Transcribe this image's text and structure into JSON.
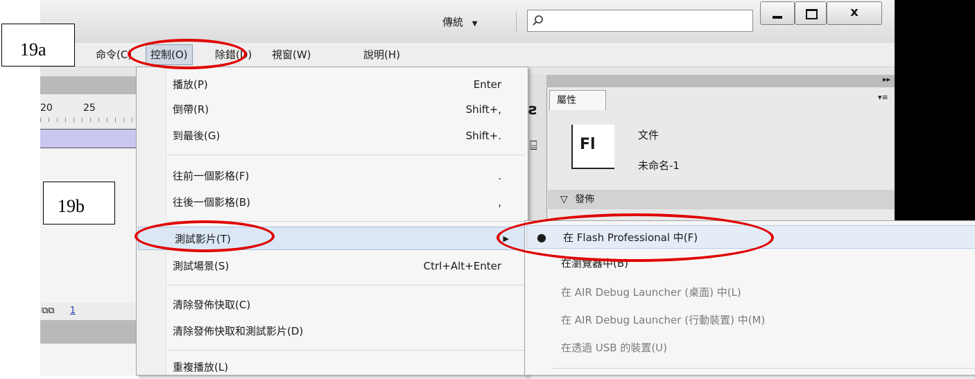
{
  "titlebar": {
    "workspace_label": "傳統",
    "search_placeholder": ""
  },
  "window_controls": {
    "minimize": "_",
    "maximize": "□",
    "close": "x"
  },
  "menubar": {
    "items": [
      "命令(C)",
      "控制(O)",
      "除錯(D)",
      "視窗(W)",
      "說明(H)"
    ]
  },
  "timeline": {
    "ticks": [
      "20",
      "25"
    ],
    "frame_number": "1"
  },
  "control_menu": {
    "items": [
      {
        "label": "播放(P)",
        "shortcut": "Enter"
      },
      {
        "label": "倒帶(R)",
        "shortcut": "Shift+,"
      },
      {
        "label": "到最後(G)",
        "shortcut": "Shift+."
      },
      {
        "label": "往前一個影格(F)",
        "shortcut": "."
      },
      {
        "label": "往後一個影格(B)",
        "shortcut": ","
      },
      {
        "label": "測試影片(T)",
        "shortcut": ""
      },
      {
        "label": "測試場景(S)",
        "shortcut": "Ctrl+Alt+Enter"
      },
      {
        "label": "清除發佈快取(C)",
        "shortcut": ""
      },
      {
        "label": "清除發佈快取和測試影片(D)",
        "shortcut": ""
      },
      {
        "label": "重複播放(L)",
        "shortcut": ""
      }
    ]
  },
  "test_movie_submenu": {
    "items": [
      {
        "label": "在 Flash Professional 中(F)",
        "checked": true,
        "enabled": true
      },
      {
        "label": "在瀏覽器中(B)",
        "checked": false,
        "enabled": true
      },
      {
        "label": "在 AIR Debug Launcher (桌面) 中(L)",
        "checked": false,
        "enabled": false
      },
      {
        "label": "在 AIR Debug Launcher (行動裝置) 中(M)",
        "checked": false,
        "enabled": false
      },
      {
        "label": "在透過 USB 的裝置(U)",
        "checked": false,
        "enabled": false
      }
    ]
  },
  "properties_panel": {
    "tab_label": "屬性",
    "logo_text": "Fl",
    "doc_type": "文件",
    "doc_name": "未命名-1",
    "section_label": "發佈"
  },
  "annotations": {
    "a": "19a",
    "b": "19b"
  },
  "colors": {
    "highlight_oval": "#e00000",
    "menu_bg": "#f6f6f6",
    "selected_item": "#dbe7f5"
  }
}
